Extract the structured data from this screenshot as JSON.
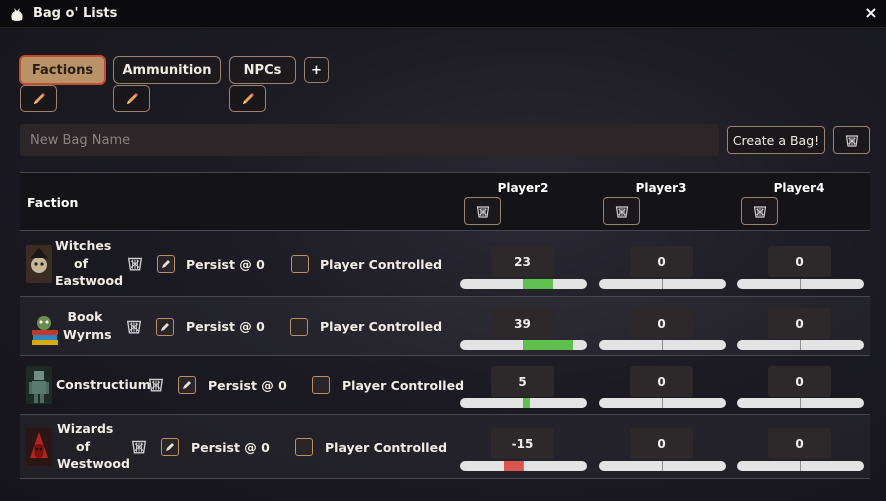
{
  "window": {
    "title": "Bag o' Lists",
    "close_label": "×"
  },
  "tabs": [
    {
      "label": "Factions",
      "active": true
    },
    {
      "label": "Ammunition",
      "active": false
    },
    {
      "label": "NPCs",
      "active": false
    }
  ],
  "add_tab_label": "+",
  "new_bag": {
    "placeholder": "New Bag Name",
    "value": "",
    "create_label": "Create a Bag!"
  },
  "table": {
    "faction_header": "Faction",
    "players": [
      "Player2",
      "Player3",
      "Player4"
    ],
    "rows": [
      {
        "name_lines": [
          "Witches",
          "of",
          "Eastwood"
        ],
        "persist_label": "Persist @ 0",
        "controlled_label": "Player Controlled",
        "values": [
          "23",
          "0",
          "0"
        ],
        "levels": [
          23,
          0,
          0
        ]
      },
      {
        "name_lines": [
          "Book",
          "Wyrms"
        ],
        "persist_label": "Persist @ 0",
        "controlled_label": "Player Controlled",
        "values": [
          "39",
          "0",
          "0"
        ],
        "levels": [
          39,
          0,
          0
        ]
      },
      {
        "name_lines": [
          "Constructium"
        ],
        "persist_label": "Persist @ 0",
        "controlled_label": "Player Controlled",
        "values": [
          "5",
          "0",
          "0"
        ],
        "levels": [
          5,
          0,
          0
        ]
      },
      {
        "name_lines": [
          "Wizards",
          "of",
          "Westwood"
        ],
        "persist_label": "Persist @ 0",
        "controlled_label": "Player Controlled",
        "values": [
          "-15",
          "0",
          "0"
        ],
        "levels": [
          -15,
          0,
          0
        ]
      }
    ],
    "scale_max": 50
  },
  "colors": {
    "accent": "#b99268",
    "active_border": "#c34a33",
    "positive": "#5fbf4f",
    "negative": "#d9574f"
  },
  "icons": {
    "app": "bag-icon",
    "edit": "pencil-icon",
    "delete": "trash-basket-icon",
    "persist": "pencil-square-icon"
  }
}
